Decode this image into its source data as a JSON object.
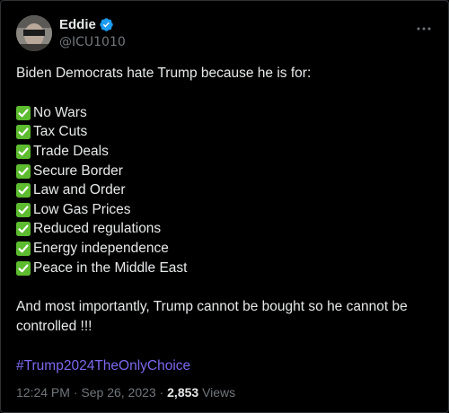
{
  "author": {
    "display_name": "Eddie",
    "handle": "@ICU1010",
    "verified": true
  },
  "tweet": {
    "intro": "Biden Democrats hate Trump because he is for:",
    "items": [
      "No Wars",
      "Tax Cuts",
      "Trade Deals",
      "Secure Border",
      "Law and Order",
      "Low Gas Prices",
      "Reduced regulations",
      "Energy independence",
      "Peace in the Middle East"
    ],
    "closing": "And most importantly, Trump cannot be bought so he cannot be controlled !!!",
    "hashtag": "#Trump2024TheOnlyChoice"
  },
  "meta": {
    "time": "12:24 PM",
    "separator_1": "·",
    "date": "Sep 26, 2023",
    "separator_2": "·",
    "views_count": "2,853",
    "views_label": "Views"
  },
  "icons": {
    "verified": "verified-badge-icon",
    "more": "more-horizontal-icon",
    "check": "white-check-mark-icon"
  },
  "colors": {
    "background": "#000000",
    "text": "#e7e9ea",
    "secondary": "#71767b",
    "verified": "#1d9bf0",
    "hashtag": "#7b68ee",
    "check_green": "#5dbb2f"
  }
}
